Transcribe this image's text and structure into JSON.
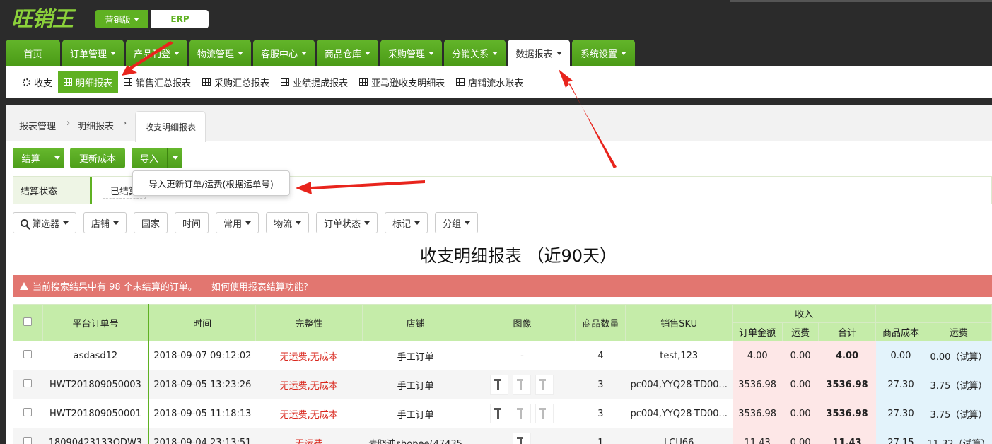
{
  "header": {
    "logo_text": "旺销王",
    "edition_label": "营销版",
    "erp_label": "ERP"
  },
  "nav": [
    {
      "label": "首页",
      "caret": false
    },
    {
      "label": "订单管理",
      "caret": true
    },
    {
      "label": "产品刊登",
      "caret": true
    },
    {
      "label": "物流管理",
      "caret": true
    },
    {
      "label": "客服中心",
      "caret": true
    },
    {
      "label": "商品仓库",
      "caret": true
    },
    {
      "label": "采购管理",
      "caret": true
    },
    {
      "label": "分销关系",
      "caret": true
    },
    {
      "label": "数据报表",
      "caret": true,
      "active": true
    },
    {
      "label": "系统设置",
      "caret": true
    }
  ],
  "subnav": [
    {
      "label": "收支",
      "icon": "ring-icon"
    },
    {
      "label": "明细报表",
      "icon": "table-icon",
      "active": true
    },
    {
      "label": "销售汇总报表",
      "icon": "table-icon"
    },
    {
      "label": "采购汇总报表",
      "icon": "table-icon"
    },
    {
      "label": "业绩提成报表",
      "icon": "table-icon"
    },
    {
      "label": "亚马逊收支明细表",
      "icon": "table-icon"
    },
    {
      "label": "店铺流水账表",
      "icon": "table-icon"
    }
  ],
  "breadcrumb": {
    "items": [
      "报表管理",
      "明细报表"
    ],
    "current_tab": "收支明细报表"
  },
  "toolbar": {
    "settle_label": "结算",
    "update_cost_label": "更新成本",
    "import_label": "导入",
    "import_menu_item": "导入更新订单/运费(根据运单号)"
  },
  "status_filter": {
    "label": "结算状态",
    "option": "已结算"
  },
  "filters": [
    "筛选器",
    "店铺",
    "国家",
    "时间",
    "常用",
    "物流",
    "订单状态",
    "标记",
    "分组"
  ],
  "report_title": "收支明细报表 （近90天）",
  "alert": {
    "text": "当前搜索结果中有 98 个未结算的订单。",
    "link": "如何使用报表结算功能？"
  },
  "table": {
    "headers": {
      "order_no": "平台订单号",
      "time": "时间",
      "integrity": "完整性",
      "store": "店铺",
      "image": "图像",
      "qty": "商品数量",
      "sku": "销售SKU",
      "income": "收入",
      "order_amount": "订单金额",
      "freight_in": "运费",
      "total": "合计",
      "cost": "商品成本",
      "freight_out": "运费"
    },
    "rows": [
      {
        "order_no": "asdasd12",
        "time": "2018-09-07 09:12:02",
        "integrity": "无运费,无成本",
        "store": "手工订单",
        "image": "-",
        "qty": "4",
        "sku": "test,123",
        "order_amount": "4.00",
        "freight_in": "0.00",
        "total": "4.00",
        "cost": "0.00",
        "freight_out": "0.00（试算）"
      },
      {
        "order_no": "HWT201809050003",
        "time": "2018-09-05 13:23:26",
        "integrity": "无运费,无成本",
        "store": "手工订单",
        "image": "",
        "qty": "3",
        "sku": "pc004,YYQ28-TD00...",
        "order_amount": "3536.98",
        "freight_in": "0.00",
        "total": "3536.98",
        "cost": "27.30",
        "freight_out": "3.75（试算）"
      },
      {
        "order_no": "HWT201809050001",
        "time": "2018-09-05 11:18:13",
        "integrity": "无运费,无成本",
        "store": "手工订单",
        "image": "",
        "qty": "3",
        "sku": "pc004,YYQ28-TD00...",
        "order_amount": "3536.98",
        "freight_in": "0.00",
        "total": "3536.98",
        "cost": "27.30",
        "freight_out": "3.75（试算）"
      },
      {
        "order_no": "18090423133QDW3",
        "time": "2018-09-04 23:13:51",
        "integrity": "无运费",
        "store": "麦晓迪shopee(47435",
        "image": "",
        "qty": "1",
        "sku": "LCU66",
        "order_amount": "11.43",
        "freight_in": "0.00",
        "total": "11.43",
        "cost": "27.15",
        "freight_out": "11.32（试算）"
      }
    ]
  },
  "colors": {
    "brand_green": "#5fb122",
    "header_bg": "#2b2b2b",
    "alert_red": "#e27670",
    "warn_text_red": "#d9261c",
    "arrow_red": "#e8241c"
  }
}
